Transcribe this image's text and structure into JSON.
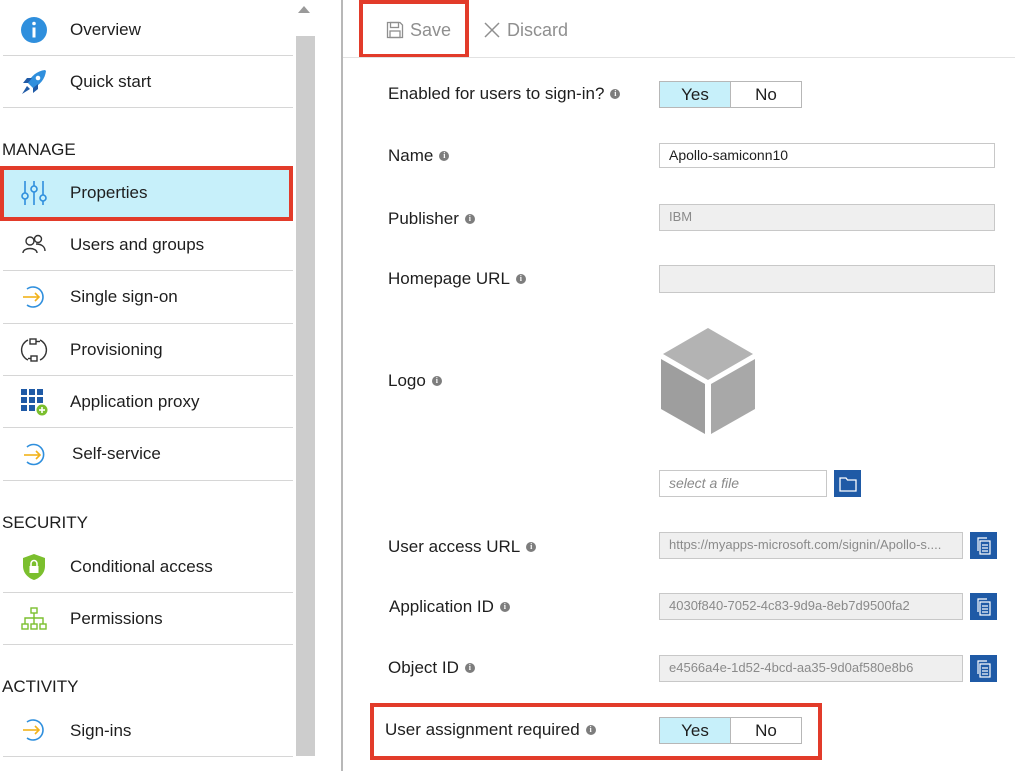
{
  "sidebar": {
    "items": [
      {
        "label": "Overview",
        "icon": "info-icon"
      },
      {
        "label": "Quick start",
        "icon": "rocket-icon"
      }
    ],
    "sections": [
      "MANAGE",
      "SECURITY",
      "ACTIVITY"
    ],
    "manage": [
      {
        "label": "Properties",
        "icon": "sliders-icon",
        "selected": true
      },
      {
        "label": "Users and groups",
        "icon": "users-icon"
      },
      {
        "label": "Single sign-on",
        "icon": "sign-on-arrow-icon"
      },
      {
        "label": "Provisioning",
        "icon": "provisioning-icon"
      },
      {
        "label": "Application proxy",
        "icon": "grid-plus-icon"
      },
      {
        "label": "Self-service",
        "icon": "self-service-arrow-icon"
      }
    ],
    "security": [
      {
        "label": "Conditional access",
        "icon": "shield-lock-icon"
      },
      {
        "label": "Permissions",
        "icon": "hierarchy-icon"
      }
    ],
    "activity": [
      {
        "label": "Sign-ins",
        "icon": "sign-in-arrow-icon"
      }
    ]
  },
  "toolbar": {
    "save_label": "Save",
    "discard_label": "Discard"
  },
  "form": {
    "enabled_label": "Enabled for users to sign-in?",
    "name_label": "Name",
    "name_value": "Apollo-samiconn10",
    "publisher_label": "Publisher",
    "publisher_value": "IBM",
    "homepage_label": "Homepage URL",
    "homepage_value": "",
    "logo_label": "Logo",
    "file_placeholder": "select a file",
    "user_access_url_label": "User access URL",
    "user_access_url_value": "https://myapps-microsoft.com/signin/Apollo-s....",
    "application_id_label": "Application ID",
    "application_id_value": "4030f840-7052-4c83-9d9a-8eb7d9500fa2",
    "object_id_label": "Object ID",
    "object_id_value": "e4566a4e-1d52-4bcd-aa35-9d0af580e8b6",
    "user_assignment_label": "User assignment required",
    "toggle_yes": "Yes",
    "toggle_no": "No",
    "enabled_selected": "Yes",
    "assignment_selected": "Yes"
  },
  "colors": {
    "selected_bg": "#c7f0fa",
    "highlight_border": "#e23b2a",
    "icon_blue": "#1f5aa6"
  }
}
